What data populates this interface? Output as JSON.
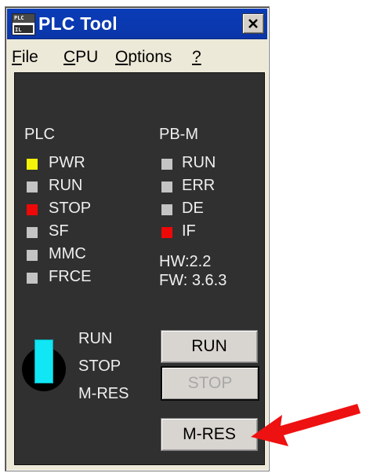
{
  "window": {
    "title": "PLC Tool",
    "icon_text_top": "PLC",
    "icon_text_bottom": "IL"
  },
  "menu": [
    {
      "label": "File",
      "mnemonic": "F",
      "rest": "ile"
    },
    {
      "label": "CPU",
      "mnemonic": "C",
      "rest": "PU"
    },
    {
      "label": "Options",
      "mnemonic": "O",
      "rest": "ptions"
    },
    {
      "label": "?",
      "mnemonic": "?",
      "rest": ""
    }
  ],
  "plc": {
    "heading": "PLC",
    "leds": [
      {
        "label": "PWR",
        "color": "#f4f40a"
      },
      {
        "label": "RUN",
        "color": "#c4c4c4"
      },
      {
        "label": "STOP",
        "color": "#ee0808"
      },
      {
        "label": "SF",
        "color": "#c4c4c4"
      },
      {
        "label": "MMC",
        "color": "#c4c4c4"
      },
      {
        "label": "FRCE",
        "color": "#c4c4c4"
      }
    ]
  },
  "pbm": {
    "heading": "PB-M",
    "leds": [
      {
        "label": "RUN",
        "color": "#c4c4c4"
      },
      {
        "label": "ERR",
        "color": "#c4c4c4"
      },
      {
        "label": "DE",
        "color": "#c4c4c4"
      },
      {
        "label": "IF",
        "color": "#ee0808"
      }
    ],
    "hw": "HW:2.2",
    "fw": "FW: 3.6.3"
  },
  "switch": {
    "positions": [
      "RUN",
      "STOP",
      "M-RES"
    ],
    "indicator_color": "#10e6f4"
  },
  "buttons": {
    "run": "RUN",
    "stop": "STOP",
    "mres": "M-RES"
  },
  "colors": {
    "panel_bg": "#303030",
    "titlebar": "#0a3cb8",
    "arrow": "#ee1111"
  }
}
